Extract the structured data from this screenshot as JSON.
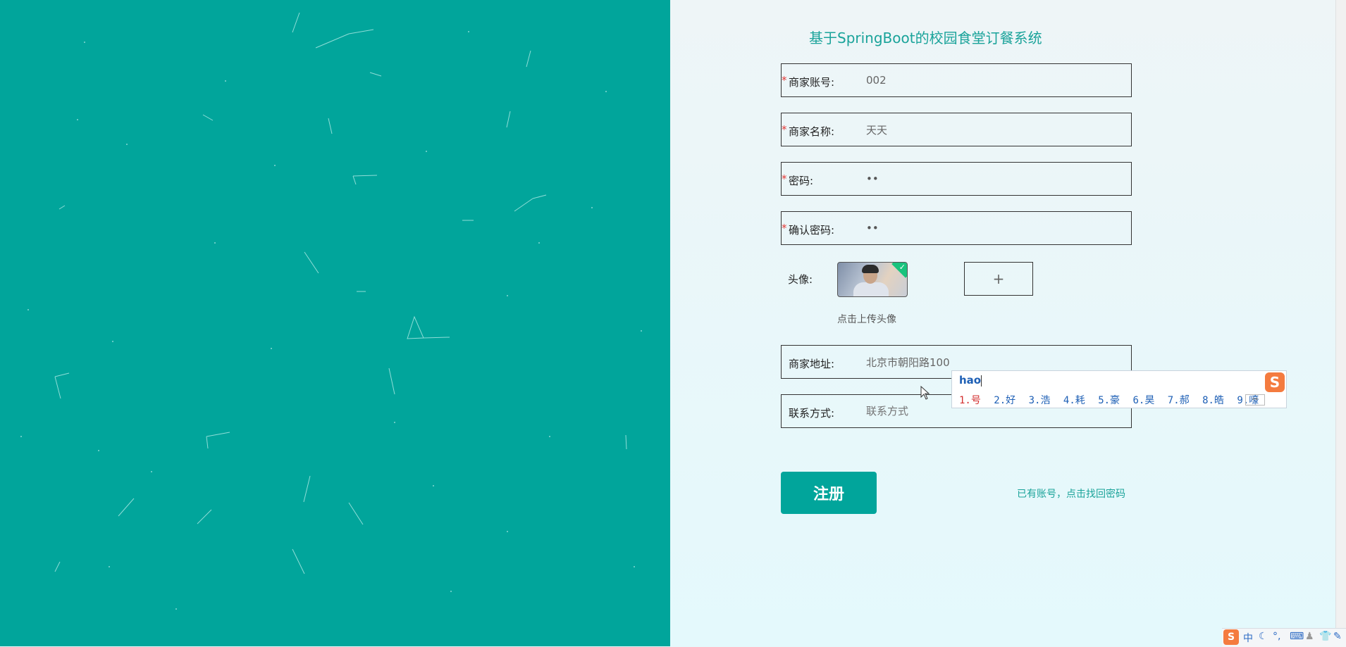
{
  "app": {
    "title": "基于SpringBoot的校园食堂订餐系统"
  },
  "colors": {
    "brand": "#01a59b",
    "required": "#e53935",
    "link": "#1aa39a"
  },
  "form": {
    "account": {
      "label": "商家账号:",
      "value": "002",
      "required": "*"
    },
    "name": {
      "label": "商家名称:",
      "value": "天天",
      "required": "*"
    },
    "password": {
      "label": "密码:",
      "value": "••",
      "required": "*"
    },
    "confirm_password": {
      "label": "确认密码:",
      "value": "••",
      "required": "*"
    },
    "avatar": {
      "label": "头像:",
      "hint": "点击上传头像",
      "upload_symbol": "+"
    },
    "address": {
      "label": "商家地址:",
      "value": "北京市朝阳路100"
    },
    "contact": {
      "label": "联系方式:",
      "placeholder": "联系方式"
    },
    "submit_label": "注册",
    "login_link": "已有账号，点击找回密码"
  },
  "ime": {
    "input": "hao",
    "candidates": [
      "1.号",
      "2.好",
      "3.浩",
      "4.耗",
      "5.豪",
      "6.昊",
      "7.郝",
      "8.皓",
      "9.嚎"
    ],
    "logo": "S",
    "pager": "◂▸"
  },
  "taskbar": {
    "items": [
      "中",
      "☾",
      "°,",
      "⌨",
      "♟",
      "👕",
      "✎"
    ]
  }
}
